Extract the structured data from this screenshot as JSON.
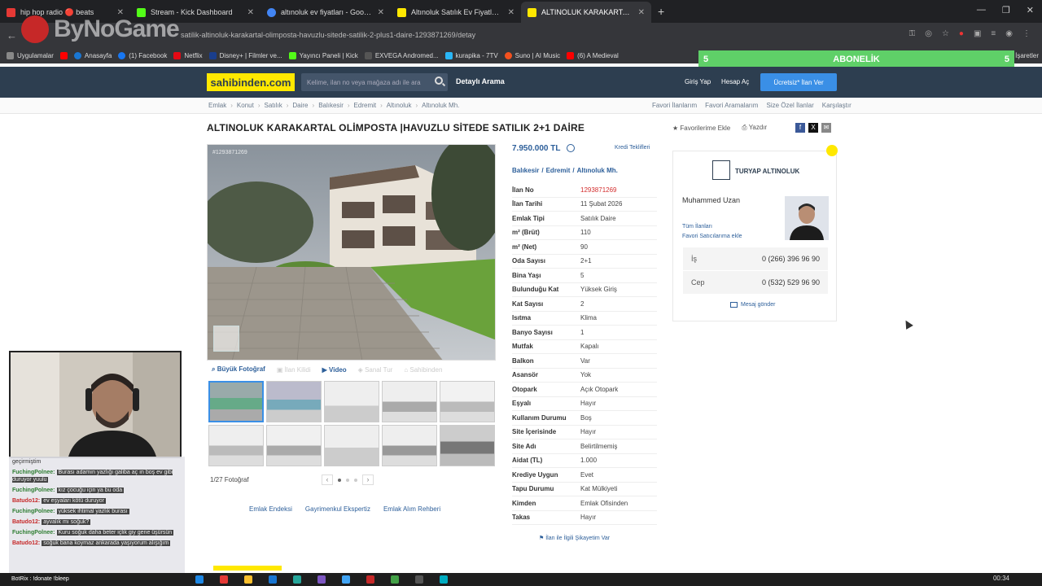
{
  "browser": {
    "tabs": [
      {
        "title": "hip hop radio 🔴 beats",
        "color": "#e53935"
      },
      {
        "title": "Stream - Kick Dashboard",
        "color": "#53fc18"
      },
      {
        "title": "altınoluk ev fiyatları - Google'da",
        "color": "#4285f4"
      },
      {
        "title": "Altınoluk Satılık Ev Fiyatları sah",
        "color": "#ffe800"
      },
      {
        "title": "ALTINOLUK KARAKARTAL OLİM",
        "color": "#ffe800"
      }
    ],
    "url": "satilik-altinoluk-karakartal-olimposta-havuzlu-sitede-satilik-2-plus1-daire-1293871269/detay",
    "bookmarks": [
      {
        "label": "Uygulamalar",
        "color": "#888"
      },
      {
        "label": "",
        "color": "#ff0000"
      },
      {
        "label": "Anasayfa",
        "color": "#1976d2"
      },
      {
        "label": "(1) Facebook",
        "color": "#1877f2"
      },
      {
        "label": "Netflix",
        "color": "#e50914"
      },
      {
        "label": "Disney+ | Filmler ve...",
        "color": "#1a3e8c"
      },
      {
        "label": "Yayıncı Paneli | Kick",
        "color": "#53fc18"
      },
      {
        "label": "EXVEGA Andromed...",
        "color": "#555"
      },
      {
        "label": "kurapika - 7TV",
        "color": "#29b6f6"
      },
      {
        "label": "Suno | AI Music",
        "color": "#f4511e"
      },
      {
        "label": "(6) A Medieval",
        "color": "#ff0000"
      },
      {
        "label": "İşaretler",
        "color": "#888"
      }
    ],
    "overlay_logo": "ByNoGame",
    "abonelik": {
      "label": "ABONELİK",
      "left": "5",
      "right": "5"
    }
  },
  "site": {
    "brand": "sahibinden.com",
    "search_placeholder": "Kelime, ilan no veya mağaza adı ile ara",
    "detailed_search": "Detaylı Arama",
    "login": "Giriş Yap",
    "register": "Hesap Aç",
    "post_ad": "Ücretsiz* İlan Ver"
  },
  "breadcrumbs": [
    "Emlak",
    "Konut",
    "Satılık",
    "Daire",
    "Balıkesir",
    "Edremit",
    "Altınoluk",
    "Altınoluk Mh."
  ],
  "right_links": [
    "Favori İlanlarım",
    "Favori Aramalarım",
    "Size Özel İlanlar",
    "Karşılaştır"
  ],
  "listing": {
    "title": "ALTINOLUK KARAKARTAL OLİMPOSTA |HAVUZLU SİTEDE SATILIK 2+1 DAİRE",
    "add_favorite": "Favorilerime Ekle",
    "print": "Yazdır",
    "photo_id": "#1293871269",
    "media_tabs": [
      "Büyük Fotoğraf",
      "İlan Kilidi",
      "Video",
      "Sanal Tur",
      "Sahibinden"
    ],
    "photo_count": "1/27 Fotoğraf",
    "price": "7.950.000 TL",
    "credit": "Kredi Teklifleri",
    "location": [
      "Balıkesir",
      "Edremit",
      "Altınoluk Mh."
    ],
    "attributes": [
      {
        "k": "İlan No",
        "v": "1293871269"
      },
      {
        "k": "İlan Tarihi",
        "v": "11 Şubat 2026"
      },
      {
        "k": "Emlak Tipi",
        "v": "Satılık Daire"
      },
      {
        "k": "m² (Brüt)",
        "v": "110"
      },
      {
        "k": "m² (Net)",
        "v": "90"
      },
      {
        "k": "Oda Sayısı",
        "v": "2+1"
      },
      {
        "k": "Bina Yaşı",
        "v": "5"
      },
      {
        "k": "Bulunduğu Kat",
        "v": "Yüksek Giriş"
      },
      {
        "k": "Kat Sayısı",
        "v": "2"
      },
      {
        "k": "Isıtma",
        "v": "Klima"
      },
      {
        "k": "Banyo Sayısı",
        "v": "1"
      },
      {
        "k": "Mutfak",
        "v": "Kapalı"
      },
      {
        "k": "Balkon",
        "v": "Var"
      },
      {
        "k": "Asansör",
        "v": "Yok"
      },
      {
        "k": "Otopark",
        "v": "Açık Otopark"
      },
      {
        "k": "Eşyalı",
        "v": "Hayır"
      },
      {
        "k": "Kullanım Durumu",
        "v": "Boş"
      },
      {
        "k": "Site İçerisinde",
        "v": "Hayır"
      },
      {
        "k": "Site Adı",
        "v": "Belirtilmemiş"
      },
      {
        "k": "Aidat (TL)",
        "v": "1.000"
      },
      {
        "k": "Krediye Uygun",
        "v": "Evet"
      },
      {
        "k": "Tapu Durumu",
        "v": "Kat Mülkiyeti"
      },
      {
        "k": "Kimden",
        "v": "Emlak Ofisinden"
      },
      {
        "k": "Takas",
        "v": "Hayır"
      }
    ],
    "bottom_links": [
      "Emlak Endeksi",
      "Gayrimenkul Ekspertiz",
      "Emlak Alım Rehberi"
    ],
    "report": "İlan ile İlgili Şikayetim Var"
  },
  "seller": {
    "office": "TURYAP ALTINOLUK",
    "name": "Muhammed Uzan",
    "all_listings": "Tüm İlanları",
    "fav_seller": "Favori Satıcılarıma ekle",
    "phones": [
      {
        "label": "İş",
        "value": "0 (266) 396 96 90"
      },
      {
        "label": "Cep",
        "value": "0 (532) 529 96 90"
      }
    ],
    "message": "Mesaj gönder"
  },
  "chat": {
    "lines": [
      {
        "user": "",
        "text": "geçirmiştim",
        "color": "#333"
      },
      {
        "user": "FuchingPolnee:",
        "text": "Burası adamın yazlığı galiba aç ın boş ev gibi duruyor yuulu",
        "color": "#2e7d32"
      },
      {
        "user": "FuchingPolnee:",
        "text": "kız çocuğu için ya bu oda",
        "color": "#2e7d32"
      },
      {
        "user": "Batudo12:",
        "text": "ev eşyaları kötü duruyor",
        "color": "#c62828"
      },
      {
        "user": "FuchingPolnee:",
        "text": "yüksek ihtimal yazlık burası",
        "color": "#2e7d32"
      },
      {
        "user": "Batudo12:",
        "text": "ayvalık mı soğuk?",
        "color": "#c62828"
      },
      {
        "user": "FuchingPolnee:",
        "text": "Kuru soğuk daha beter içlik giy gene üşürsün",
        "color": "#2e7d32"
      },
      {
        "user": "Batudo12:",
        "text": "soğuk bana koymaz ankarada yaşıyorum alışığım",
        "color": "#c62828"
      }
    ],
    "botrix": "BotRix : !donate !bleep"
  },
  "taskbar": {
    "clock": "00:34"
  }
}
